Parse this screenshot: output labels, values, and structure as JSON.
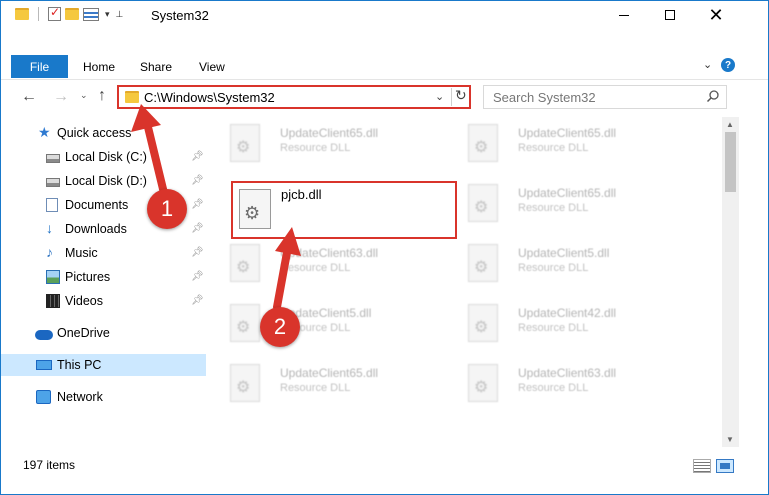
{
  "window": {
    "title": "System32",
    "minimize_icon": "minimize-icon",
    "maximize_icon": "maximize-icon",
    "close_glyph": "✕"
  },
  "ribbon": {
    "tabs": [
      {
        "label": "File"
      },
      {
        "label": "Home"
      },
      {
        "label": "Share"
      },
      {
        "label": "View"
      }
    ],
    "help_glyph": "?"
  },
  "nav": {
    "address": "C:\\Windows\\System32",
    "search_placeholder": "Search System32"
  },
  "sidebar": {
    "items": [
      {
        "label": "Quick access",
        "icon": "quick-access-star-icon"
      },
      {
        "label": "Local Disk (C:)",
        "icon": "drive-icon",
        "pinned": true
      },
      {
        "label": "Local Disk (D:)",
        "icon": "drive-icon",
        "pinned": true
      },
      {
        "label": "Documents",
        "icon": "documents-icon",
        "pinned": true
      },
      {
        "label": "Downloads",
        "icon": "downloads-icon",
        "pinned": true
      },
      {
        "label": "Music",
        "icon": "music-icon",
        "pinned": true
      },
      {
        "label": "Pictures",
        "icon": "pictures-icon",
        "pinned": true
      },
      {
        "label": "Videos",
        "icon": "videos-icon",
        "pinned": true
      },
      {
        "label": "OneDrive",
        "icon": "onedrive-icon"
      },
      {
        "label": "This PC",
        "icon": "this-pc-icon",
        "selected": true
      },
      {
        "label": "Network",
        "icon": "network-icon"
      }
    ]
  },
  "files": {
    "left": [
      {
        "name": "UpdateClient65.dll",
        "type": "Resource DLL"
      },
      {
        "name": "UpdateClient63.dll",
        "type": "Resource DLL"
      },
      {
        "name": "UpdateClient5.dll",
        "type": "Resource DLL"
      },
      {
        "name": "UpdateClient65.dll",
        "type": "Resource DLL"
      }
    ],
    "right": [
      {
        "name": "UpdateClient65.dll",
        "type": "Resource DLL"
      },
      {
        "name": "UpdateClient65.dll",
        "type": "Resource DLL"
      },
      {
        "name": "UpdateClient5.dll",
        "type": "Resource DLL"
      },
      {
        "name": "UpdateClient42.dll",
        "type": "Resource DLL"
      },
      {
        "name": "UpdateClient63.dll",
        "type": "Resource DLL"
      }
    ],
    "highlighted": {
      "name": "pjcb.dll"
    }
  },
  "status": {
    "item_count": "197 items"
  },
  "callouts": {
    "step1": "1",
    "step2": "2",
    "color": "#d9342b"
  }
}
